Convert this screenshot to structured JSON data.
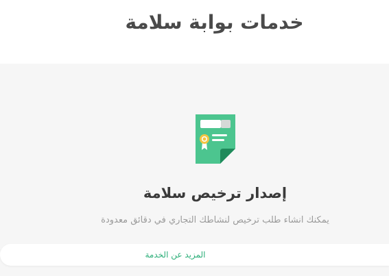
{
  "header": {
    "title": "خدمات بوابة سلامة"
  },
  "service": {
    "icon": "license-certificate-icon",
    "title": "إصدار ترخيص سلامة",
    "description": "يمكنك انشاء طلب ترخيص لنشاطك التجاري في دقائق معدودة",
    "more_label": "المزيد عن الخدمة"
  },
  "colors": {
    "accent": "#2bae78",
    "icon_green": "#4cc58f",
    "icon_dark_green": "#1f8a5b",
    "medal_yellow": "#f4c542",
    "section_bg": "#f6f6f6",
    "title_text": "#4a4a4a",
    "desc_text": "#9a9a9a"
  }
}
